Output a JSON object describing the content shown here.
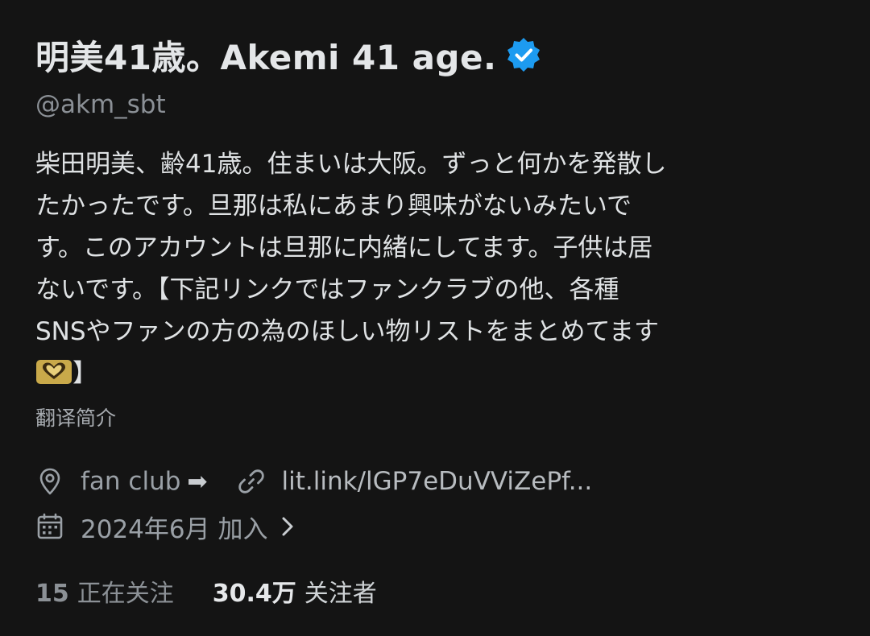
{
  "profile": {
    "display_name": "明美41歳。Akemi 41 age.",
    "handle": "@akm_sbt",
    "bio_lines": [
      "柴田明美、齢41歳。住まいは大阪。ずっと何かを発散し",
      "たかったです。旦那は私にあまり興味がないみたいで",
      "す。このアカウントは旦那に内緒にしてます。子供は居",
      "ないです。【下記リンクではファンクラブの他、各種",
      "SNSやファンの方の為のほしい物リストをまとめてます"
    ],
    "bio_last_suffix": "】",
    "translate_label": "翻译简介",
    "location": "fan club",
    "location_arrow": "➡",
    "link": "lit.link/lGP7eDuVViZePf...",
    "joined": "2024年6月 加入",
    "following_count": "15",
    "following_label": "正在关注",
    "followers_count": "30.4万",
    "followers_label": "关注者"
  },
  "icons": {
    "verified": "verified-badge-icon",
    "heart_hands": "heart-hands-icon",
    "location": "location-pin-icon",
    "link": "link-icon",
    "calendar": "calendar-icon",
    "chevron": "chevron-right-icon"
  },
  "colors": {
    "background": "#141414",
    "verified_blue": "#1d9bf0",
    "text_primary": "#e7e9ea",
    "text_secondary": "#8b9096"
  }
}
